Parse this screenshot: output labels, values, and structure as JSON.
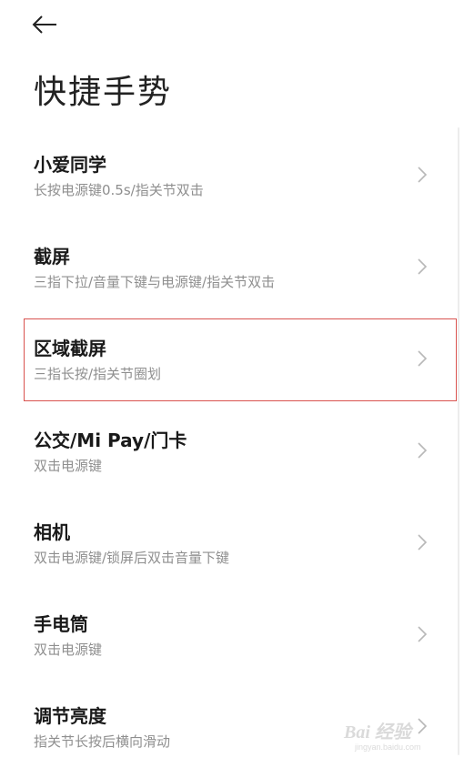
{
  "header": {
    "back_icon": "arrow-left-icon",
    "title": "快捷手势"
  },
  "items": [
    {
      "title": "小爱同学",
      "subtitle": "长按电源键0.5s/指关节双击"
    },
    {
      "title": "截屏",
      "subtitle": "三指下拉/音量下键与电源键/指关节双击"
    },
    {
      "title": "区域截屏",
      "subtitle": "三指长按/指关节圈划"
    },
    {
      "title": "公交/Mi Pay/门卡",
      "subtitle": "双击电源键"
    },
    {
      "title": "相机",
      "subtitle": "双击电源键/锁屏后双击音量下键"
    },
    {
      "title": "手电筒",
      "subtitle": "双击电源键"
    },
    {
      "title": "调节亮度",
      "subtitle": "指关节长按后横向滑动"
    }
  ],
  "chevron_icon": "chevron-right-icon",
  "highlight_color": "#d9534f",
  "watermark": {
    "text": "Bai 经验",
    "url": "jingyan.baidu.com"
  }
}
